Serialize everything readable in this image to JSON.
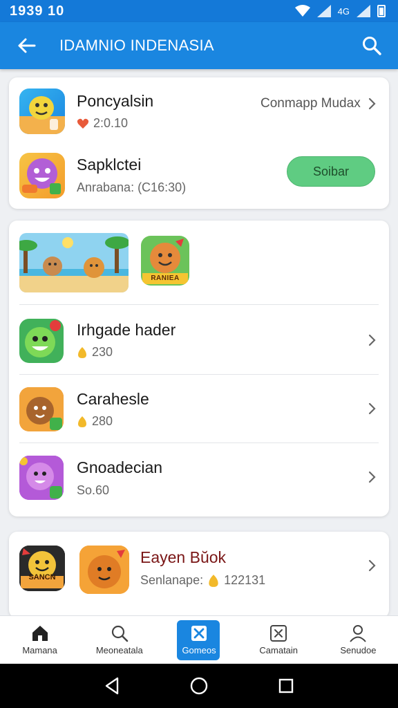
{
  "status_bar": {
    "time": "1939 10",
    "signal_label": "4G",
    "signal_label_2": "4G"
  },
  "app_bar": {
    "title": "IDAMNIO INDENASIA",
    "back_icon": "back-arrow-icon",
    "search_icon": "search-icon"
  },
  "card1": {
    "items": [
      {
        "name": "Poncyalsin",
        "meta": "2:0.10",
        "right_link": "Conmapp Mudax"
      },
      {
        "name": "Sapklctei",
        "meta": "Anrabana: (C16:30)",
        "button": "Soibar"
      }
    ]
  },
  "card2": {
    "items": [
      {
        "name": "Irhgade hader",
        "meta": "230"
      },
      {
        "name": "Carahesle",
        "meta": "280"
      },
      {
        "name": "Gnoadecian",
        "meta": "So.60"
      }
    ],
    "banner_label": "RANIEA"
  },
  "card3": {
    "name": "Eayen Bŭok",
    "meta_label": "Senlanape:",
    "meta_value": "122131",
    "icon_label": "SANCN"
  },
  "bottom_nav": {
    "items": [
      {
        "label": "Mamana"
      },
      {
        "label": "Meoneatala"
      },
      {
        "label": "Gomeos"
      },
      {
        "label": "Camatain"
      },
      {
        "label": "Senudoe"
      }
    ]
  },
  "colors": {
    "primary": "#1a86e0",
    "status_bar": "#1479d8",
    "button_green": "#5fcc82"
  }
}
